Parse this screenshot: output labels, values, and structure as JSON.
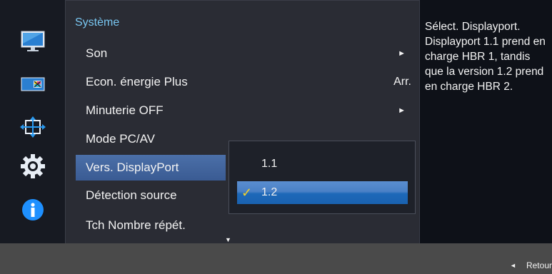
{
  "menu": {
    "title": "Système",
    "items": [
      {
        "label": "Son",
        "value": "",
        "arrow": "►"
      },
      {
        "label": "Econ. énergie Plus",
        "value": "Arr.",
        "arrow": ""
      },
      {
        "label": "Minuterie OFF",
        "value": "",
        "arrow": "►"
      },
      {
        "label": "Mode PC/AV",
        "value": "",
        "arrow": ""
      },
      {
        "label": "Vers. DisplayPort",
        "value": "",
        "arrow": "",
        "selected": true
      },
      {
        "label": "Détection source",
        "value": "",
        "arrow": ""
      },
      {
        "label": "Tch Nombre répét.",
        "value": "",
        "arrow": ""
      }
    ],
    "scroll_down": "▼"
  },
  "submenu": {
    "options": [
      {
        "label": "1.1",
        "checked": false
      },
      {
        "label": "1.2",
        "checked": true
      }
    ],
    "check_glyph": "✓"
  },
  "help": {
    "text": "Sélect. Displayport. Displayport 1.1 prend en charge HBR 1, tandis que la version 1.2 prend en charge HBR 2."
  },
  "bottom": {
    "return_arrow": "◄",
    "return_label": "Retour"
  },
  "icons": [
    "picture-icon",
    "color-icon",
    "onscreen-display-icon",
    "system-gear-icon",
    "information-icon"
  ],
  "colors": {
    "title_blue": "#79c7f2",
    "selected_blue": "#3a5b93",
    "check_yellow": "#f3d12a",
    "info_blue": "#1e90ff"
  }
}
